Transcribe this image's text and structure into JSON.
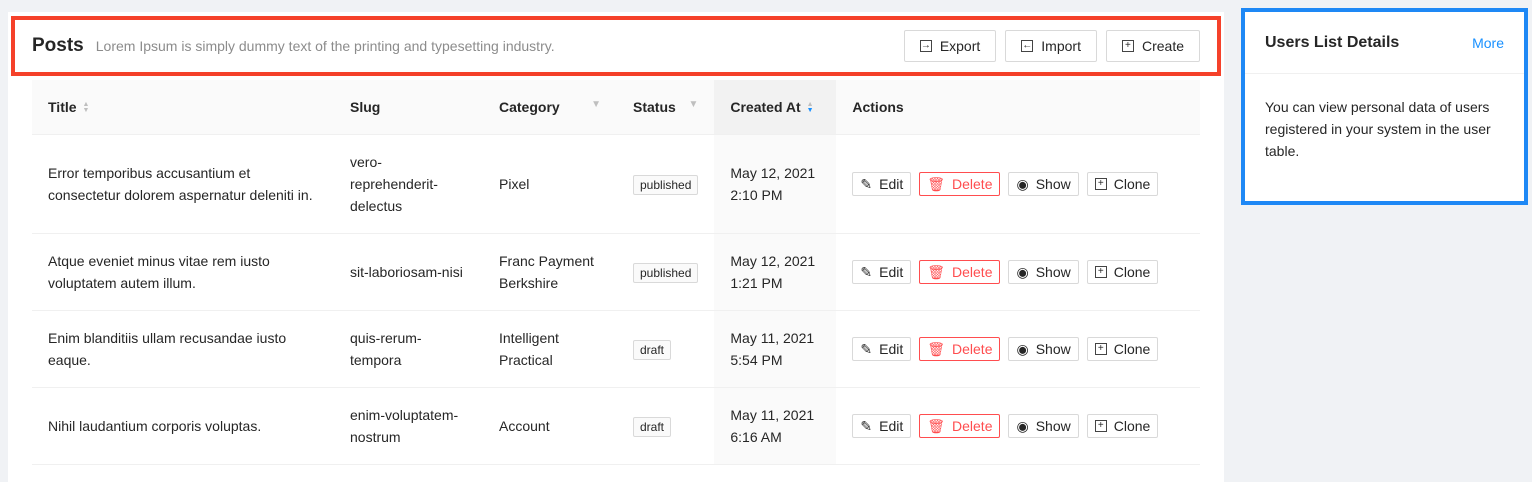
{
  "header": {
    "title": "Posts",
    "subtitle": "Lorem Ipsum is simply dummy text of the printing and typesetting industry.",
    "export": "Export",
    "import": "Import",
    "create": "Create"
  },
  "table": {
    "columns": [
      "Title",
      "Slug",
      "Category",
      "Status",
      "Created At",
      "Actions"
    ],
    "actions": {
      "edit": "Edit",
      "delete": "Delete",
      "show": "Show",
      "clone": "Clone"
    },
    "rows": [
      {
        "title": "Error temporibus accusantium et consectetur dolorem aspernatur deleniti in.",
        "slug": "vero-reprehenderit-delectus",
        "category": "Pixel",
        "status": "published",
        "date": "May 12, 2021",
        "time": "2:10 PM"
      },
      {
        "title": "Atque eveniet minus vitae rem iusto voluptatem autem illum.",
        "slug": "sit-laboriosam-nisi",
        "category": "Franc Payment Berkshire",
        "status": "published",
        "date": "May 12, 2021",
        "time": "1:21 PM"
      },
      {
        "title": "Enim blanditiis ullam recusandae iusto eaque.",
        "slug": "quis-rerum-tempora",
        "category": "Intelligent Practical",
        "status": "draft",
        "date": "May 11, 2021",
        "time": "5:54 PM"
      },
      {
        "title": "Nihil laudantium corporis voluptas.",
        "slug": "enim-voluptatem-nostrum",
        "category": "Account",
        "status": "draft",
        "date": "May 11, 2021",
        "time": "6:16 AM"
      }
    ]
  },
  "card": {
    "title": "Users List Details",
    "more": "More",
    "body": "You can view personal data of users registered in your system in the user table."
  }
}
